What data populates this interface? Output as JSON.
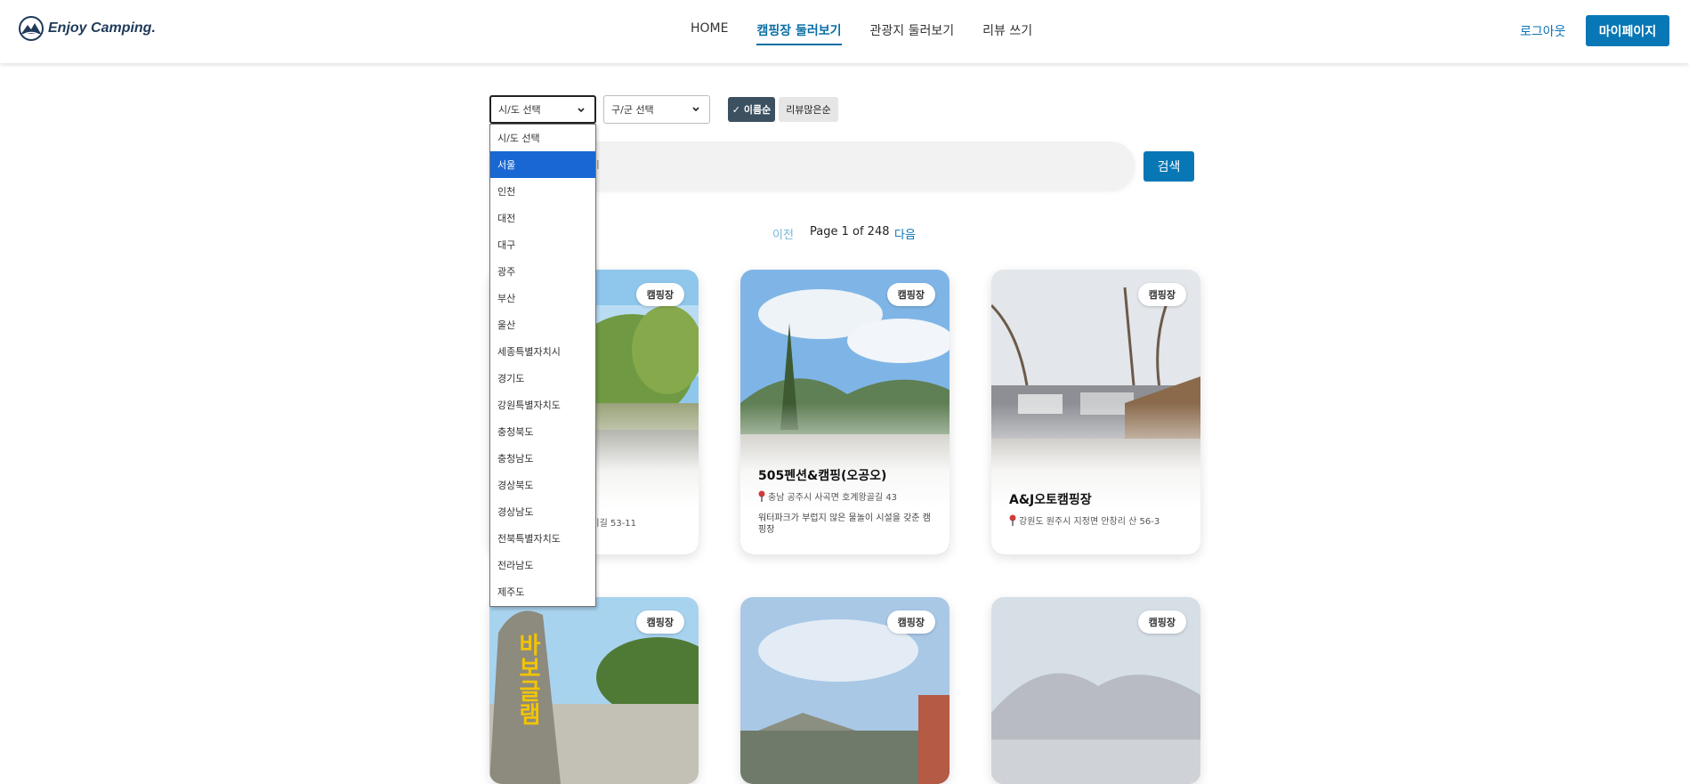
{
  "header": {
    "logo_text": "Enjoy Camping.",
    "nav": [
      "HOME",
      "캠핑장 둘러보기",
      "관광지 둘러보기",
      "리뷰 쓰기"
    ],
    "active_nav": 1,
    "logout": "로그아웃",
    "mypage": "마이페이지"
  },
  "filters": {
    "sido_value": "시/도 선택",
    "gugun_value": "구/군 선택",
    "sort_name": "✓ 이름순",
    "sort_review": "리뷰많은순",
    "sido_options": [
      "시/도 선택",
      "서울",
      "인천",
      "대전",
      "대구",
      "광주",
      "부산",
      "울산",
      "세종특별자치시",
      "경기도",
      "강원특별자치도",
      "충청북도",
      "충청남도",
      "경상북도",
      "경상남도",
      "전북특별자치도",
      "전라남도",
      "제주도"
    ],
    "sido_highlighted": "서울"
  },
  "search": {
    "visible_text": "l",
    "button": "검색"
  },
  "pagination": {
    "prev": "이전",
    "info": "Page 1 of 248",
    "next": "다음"
  },
  "cards": [
    {
      "badge": "캠핑장",
      "title": "",
      "address": "새끼미길 53-11",
      "description": ""
    },
    {
      "badge": "캠핑장",
      "title": "505펜션&캠핑(오공오)",
      "address": "충남 공주시 사곡면 호계왕골길 43",
      "description": "워터파크가 부럽지 않은 물놀이 시설을 갖춘 캠핑장"
    },
    {
      "badge": "캠핑장",
      "title": "A&J오토캠핑장",
      "address": "강원도 원주시 지정면 안창리 산 56-3",
      "description": ""
    },
    {
      "badge": "캠핑장",
      "title": "",
      "address": "",
      "description": "",
      "sign_text": "바보글램"
    },
    {
      "badge": "캠핑장",
      "title": "",
      "address": "",
      "description": ""
    },
    {
      "badge": "캠핑장",
      "title": "",
      "address": "",
      "description": ""
    }
  ],
  "colors": {
    "primary": "#0877b5",
    "sort_active": "#3b5060",
    "option_highlight": "#1967d2"
  }
}
